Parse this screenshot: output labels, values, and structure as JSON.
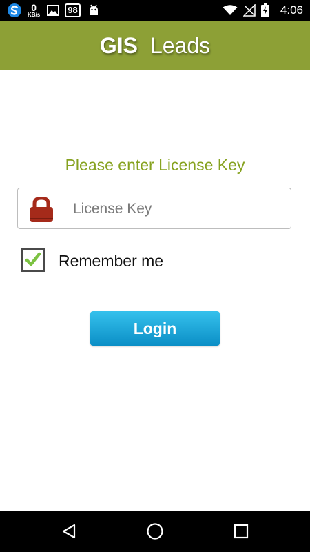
{
  "status_bar": {
    "speed_value": "0",
    "speed_unit": "KB/s",
    "badge_number": "98",
    "time": "4:06",
    "icons": [
      "swiftkey-icon",
      "image-icon",
      "android-icon",
      "wifi-icon",
      "no-sim-icon",
      "battery-charging-icon"
    ]
  },
  "app_bar": {
    "title_bold": "GIS",
    "title_regular": "Leads",
    "color": "#8da036"
  },
  "form": {
    "prompt": "Please enter License Key",
    "license_placeholder": "License Key",
    "license_value": "",
    "remember_label": "Remember me",
    "remember_checked": true,
    "login_label": "Login",
    "prompt_color": "#86a21f",
    "lock_color": "#a52a1a",
    "button_color": "#1aa6d8"
  },
  "nav_bar": {
    "items": [
      "back-icon",
      "home-icon",
      "recents-icon"
    ]
  }
}
